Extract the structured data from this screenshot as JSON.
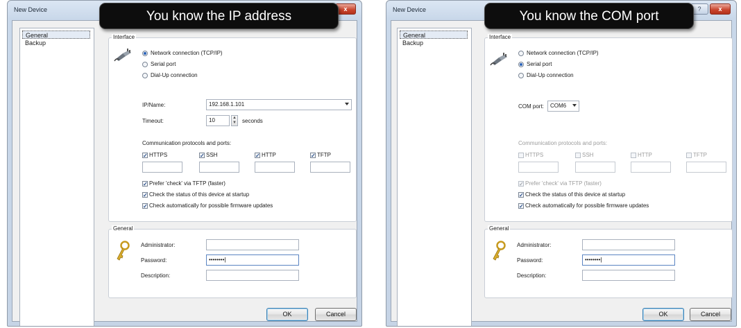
{
  "left": {
    "callout": "You know the IP address",
    "window_title": "New Device",
    "nav": [
      "General",
      "Backup"
    ],
    "interface_legend": "Interface",
    "radios": [
      "Network connection (TCP/IP)",
      "Serial port",
      "Dial-Up connection"
    ],
    "selected_radio": 0,
    "ipname_label": "IP/Name:",
    "ipname_value": "192.168.1.101",
    "timeout_label": "Timeout:",
    "timeout_value": "10",
    "timeout_unit": "seconds",
    "protocols_label": "Communication protocols and ports:",
    "protocols": [
      {
        "label": "HTTPS",
        "checked": true
      },
      {
        "label": "SSH",
        "checked": true
      },
      {
        "label": "HTTP",
        "checked": true
      },
      {
        "label": "TFTP",
        "checked": true
      }
    ],
    "checks": [
      {
        "label": "Prefer 'check' via TFTP (faster)",
        "checked": true
      },
      {
        "label": "Check the status of this device at startup",
        "checked": true
      },
      {
        "label": "Check automatically for possible firmware updates",
        "checked": true
      }
    ],
    "general_legend": "General",
    "admin_label": "Administrator:",
    "password_label": "Password:",
    "password_value": "••••••••",
    "description_label": "Description:",
    "ok": "OK",
    "cancel": "Cancel",
    "close_glyph": "x"
  },
  "right": {
    "callout": "You know the COM port",
    "window_title": "New Device",
    "nav": [
      "General",
      "Backup"
    ],
    "interface_legend": "Interface",
    "radios": [
      "Network connection (TCP/IP)",
      "Serial port",
      "Dial-Up connection"
    ],
    "selected_radio": 1,
    "com_label": "COM port:",
    "com_value": "COM6",
    "protocols_label": "Communication protocols and ports:",
    "protocols": [
      {
        "label": "HTTPS",
        "checked": false
      },
      {
        "label": "SSH",
        "checked": false
      },
      {
        "label": "HTTP",
        "checked": false
      },
      {
        "label": "TFTP",
        "checked": false
      }
    ],
    "checks": [
      {
        "label": "Prefer 'check' via TFTP (faster)",
        "checked": true
      },
      {
        "label": "Check the status of this device at startup",
        "checked": true
      },
      {
        "label": "Check automatically for possible firmware updates",
        "checked": true
      }
    ],
    "general_legend": "General",
    "admin_label": "Administrator:",
    "password_label": "Password:",
    "password_value": "••••••••",
    "description_label": "Description:",
    "ok": "OK",
    "cancel": "Cancel",
    "help_glyph": "?",
    "close_glyph": "x"
  },
  "icons": {
    "interface": "network-plug-icon",
    "general": "key-icon"
  }
}
